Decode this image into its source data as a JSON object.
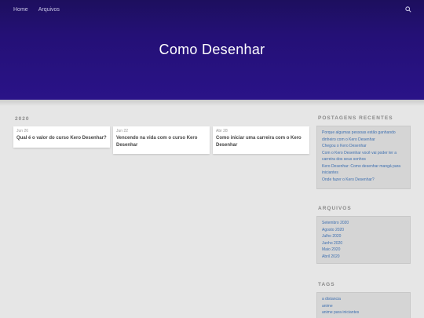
{
  "nav": {
    "home": "Home",
    "archives": "Arquivos"
  },
  "hero": {
    "title": "Como Desenhar"
  },
  "year": "2020",
  "posts": [
    {
      "date": "Jun 26",
      "title": "Qual é o valor do curso Kero Desenhar?"
    },
    {
      "date": "Jun 22",
      "title": "Vencendo na vida com o curso Kero Desenhar"
    },
    {
      "date": "Abr 28",
      "title": "Como iniciar uma carreira com o Kero Desenhar"
    }
  ],
  "sidebar": {
    "recent_title": "POSTAGENS RECENTES",
    "recent": [
      "Porque algumas pessoas estão ganhando dinheiro com o Kero Desenhar",
      "Chegou o Kero Desenhar",
      "Com o Kero Desenhar você vai poder ter a carreira dos seus sonhos",
      "Kero Desenhar: Como desenhar mangá para iniciantes",
      "Onde fazer o Kero Desenhar?"
    ],
    "archives_title": "ARQUIVOS",
    "archives": [
      "Setembro 2020",
      "Agosto 2020",
      "Julho 2020",
      "Junho 2020",
      "Maio 2020",
      "Abril 2020"
    ],
    "tags_title": "TAGS",
    "tags": [
      "a distancia",
      "anime",
      "anime para iniciantes"
    ]
  },
  "colors": {
    "hero": "#241076",
    "link": "#3d6fb0"
  }
}
